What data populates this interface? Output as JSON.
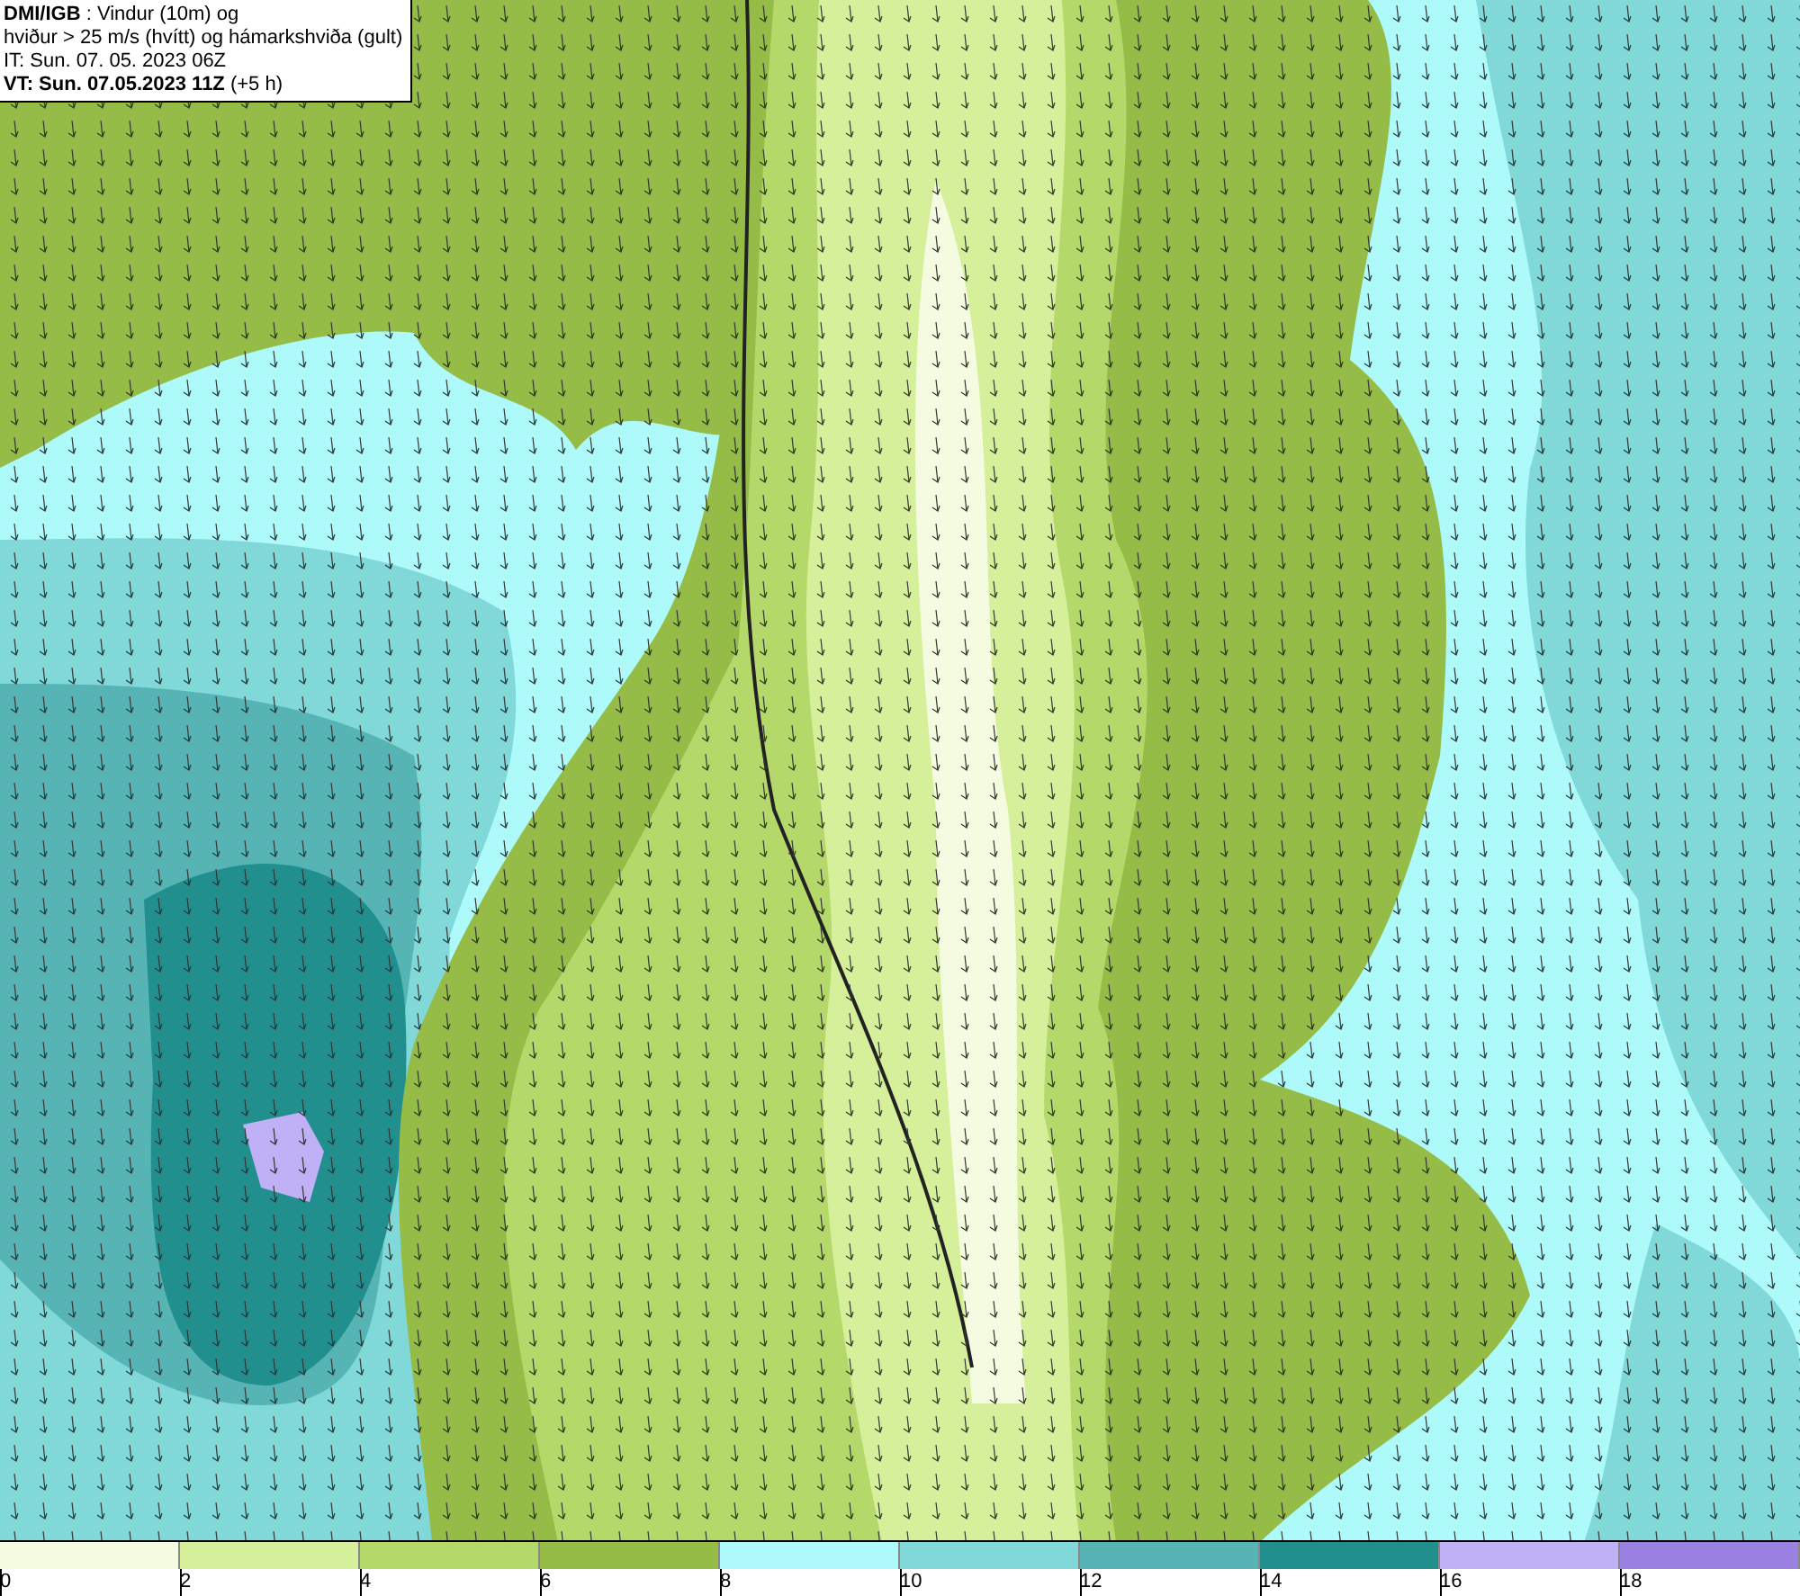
{
  "title_box": {
    "lines": [
      "**DMI/IGB** : Vindur (10m) og",
      "hviður > 25 m/s (hvítt) og hámarkshviða (gult)",
      "IT: Sun. 07. 05. 2023 06Z",
      "**VT: Sun. 07.05.2023 11Z** (+5 h)"
    ]
  },
  "legend": {
    "bins": [
      {
        "color": "#f5fbe0"
      },
      {
        "color": "#d6ef9a"
      },
      {
        "color": "#b5d86a"
      },
      {
        "color": "#96bc48"
      },
      {
        "color": "#aefafa"
      },
      {
        "color": "#80d8d8"
      },
      {
        "color": "#56b4b4"
      },
      {
        "color": "#228f8f"
      },
      {
        "color": "#c0b0f6"
      },
      {
        "color": "#9a80e0"
      }
    ],
    "ticks": [
      "0",
      "2",
      "4",
      "6",
      "8",
      "10",
      "12",
      "14",
      "16",
      "18"
    ]
  }
}
